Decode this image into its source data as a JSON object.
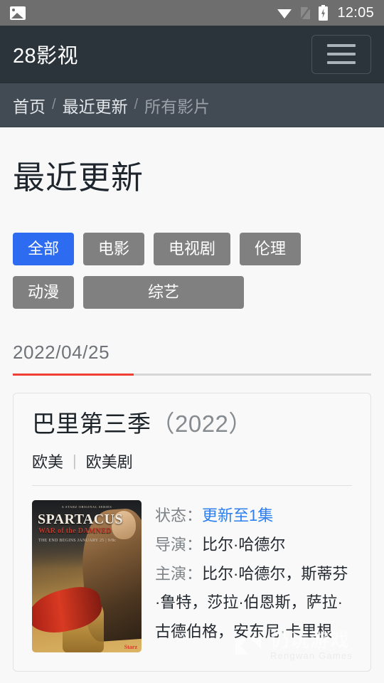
{
  "status_bar": {
    "left_icon": "image-icon",
    "icons": [
      "wifi-icon",
      "sim-card-off-icon",
      "battery-charging-icon"
    ],
    "time": "12:05",
    "bg_color": "#6e6e6e"
  },
  "navbar": {
    "brand": "28影视",
    "menu_icon": "hamburger-icon",
    "bg_color": "#2b333b"
  },
  "breadcrumb": {
    "items": [
      {
        "label": "首页",
        "dim": false
      },
      {
        "label": "最近更新",
        "dim": false
      },
      {
        "label": "所有影片",
        "dim": true
      }
    ],
    "separator": "/",
    "bg_color": "#424a54"
  },
  "page": {
    "title": "最近更新"
  },
  "filters": {
    "active_color": "#2d6cf0",
    "inactive_color": "#808080",
    "items": [
      {
        "label": "全部",
        "active": true
      },
      {
        "label": "电影",
        "active": false
      },
      {
        "label": "电视剧",
        "active": false
      },
      {
        "label": "伦理",
        "active": false
      },
      {
        "label": "动漫",
        "active": false
      },
      {
        "label": "综艺",
        "active": false
      }
    ]
  },
  "date_section": {
    "date": "2022/04/25",
    "accent_color": "#ef3e33"
  },
  "movie": {
    "title": "巴里第三季",
    "year": "（2022）",
    "region": "欧美",
    "category": "欧美剧",
    "tag_separator": "|",
    "poster": {
      "tagline": "A STARZ ORIGINAL SERIES",
      "title": "SPARTACUS",
      "subtitle": "WAR of the DAMNED",
      "date_line": "THE END BEGINS   JANUARY 25 | 9/8c",
      "network": "Starz"
    },
    "details": [
      {
        "key": "状态：",
        "value": "更新至1集",
        "is_link": true
      },
      {
        "key": "导演：",
        "value": "比尔·哈德尔",
        "is_link": false
      },
      {
        "key": "主演：",
        "value": "比尔·哈德尔，斯蒂芬·鲁特，莎拉·伯恩斯，萨拉·古德伯格，安东尼·卡里根",
        "is_link": false
      }
    ]
  },
  "watermark": {
    "cn": "仍玩游戏",
    "en": "Rengwan Games",
    "logo": "arrow-logo-icon"
  }
}
